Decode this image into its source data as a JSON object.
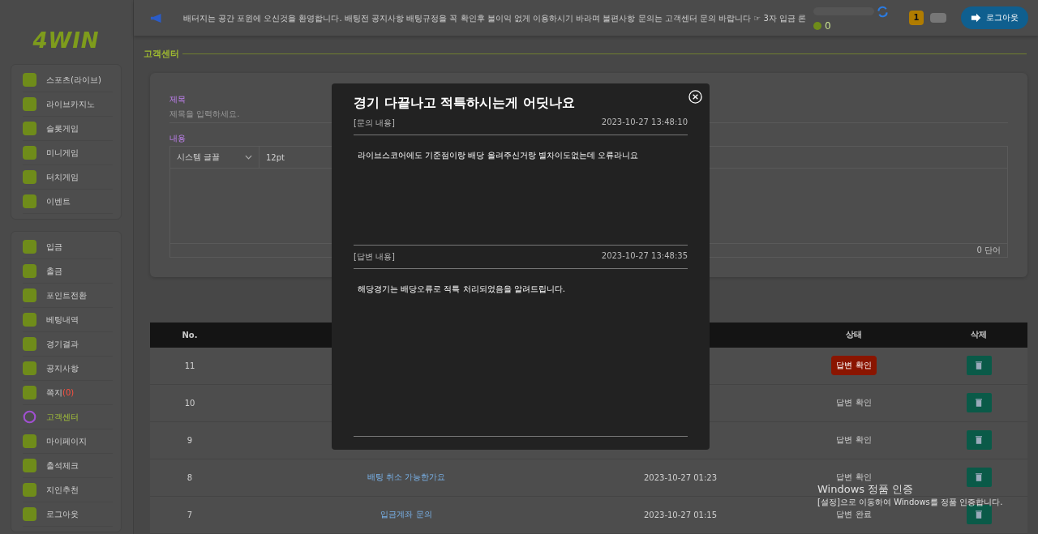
{
  "logo": "4WIN",
  "header": {
    "notice": "배터지는 공간 포윈에 오신것을 환영합니다. 배팅전 공지사항 배팅규정을 꼭 확인후 불이익 없게 이용하시기 바라며 불편사항 문의는 고객센터 문의 바랍니다 ☞ 3자 입금 론",
    "points": "0",
    "level": "1",
    "logout": "로그아웃"
  },
  "sidebar": {
    "groups": [
      {
        "items": [
          {
            "label": "스포츠(라이브)",
            "selected": false
          },
          {
            "label": "라이브카지노",
            "selected": false
          },
          {
            "label": "슬롯게임",
            "selected": false
          },
          {
            "label": "미니게임",
            "selected": false
          },
          {
            "label": "터치게임",
            "selected": false
          },
          {
            "label": "이벤트",
            "selected": false
          }
        ]
      },
      {
        "items": [
          {
            "label": "입금",
            "selected": false
          },
          {
            "label": "출금",
            "selected": false
          },
          {
            "label": "포인트전환",
            "selected": false
          },
          {
            "label": "베팅내역",
            "selected": false
          },
          {
            "label": "경기결과",
            "selected": false
          },
          {
            "label": "공지사항",
            "selected": false
          },
          {
            "label": "쪽지",
            "count": "(0)",
            "selected": false
          },
          {
            "label": "고객센터",
            "selected": true
          },
          {
            "label": "마이페이지",
            "selected": false
          },
          {
            "label": "출석체크",
            "selected": false
          },
          {
            "label": "지인추천",
            "selected": false
          },
          {
            "label": "로그아웃",
            "selected": false
          }
        ]
      }
    ]
  },
  "page_title": "고객센터",
  "form": {
    "subject_label": "제목",
    "subject_placeholder": "제목을 입력하세요.",
    "content_label": "내용",
    "font": "시스템 글꼴",
    "size": "12pt",
    "word_count": "0 단어"
  },
  "table": {
    "columns": [
      "No.",
      "상태",
      "삭제"
    ],
    "rows": [
      {
        "no": "11",
        "status": "답변 확인",
        "highlighted": true
      },
      {
        "no": "10",
        "status": "답변 확인",
        "highlighted": false
      },
      {
        "no": "9",
        "status": "답변 확인",
        "highlighted": false
      },
      {
        "no": "8",
        "title": "배팅 취소 가능한가요",
        "date": "2023-10-27 01:23",
        "status": "답변 확인",
        "highlighted": false
      },
      {
        "no": "7",
        "title": "입금계좌 문의",
        "date": "2023-10-27 01:15",
        "status": "답변 완료",
        "highlighted": false
      }
    ]
  },
  "modal": {
    "title": "경기 다끝나고 적특하시는게 어딧나요",
    "question_label": "[문의 내용]",
    "question_date": "2023-10-27 13:48:10",
    "question": "라이브스코어에도 기준점이랑 배당 올려주신거랑 별차이도없는데 오류라니요",
    "answer_label": "[답변 내용]",
    "answer_date": "2023-10-27 13:48:35",
    "answer": "해당경기는 배당오류로 적특 처리되었음을 알려드립니다."
  },
  "activation": {
    "title": "Windows 정품 인증",
    "text": "[설정]으로 이동하여 Windows를 정품 인증합니다."
  }
}
